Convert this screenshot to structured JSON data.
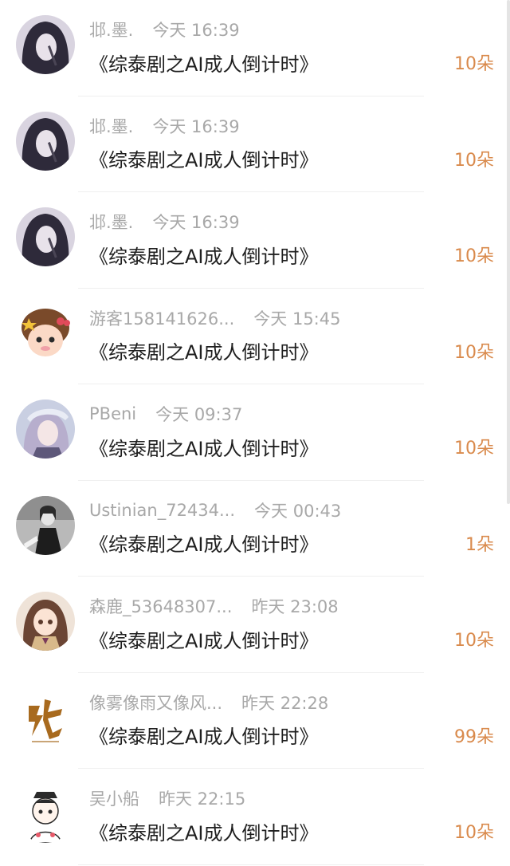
{
  "items": [
    {
      "user": "邶.墨.",
      "time": "今天 16:39",
      "title": "《综泰剧之AI成人倒计时》",
      "gift": "10朵",
      "avatar": "dark-hair-girl-avatar"
    },
    {
      "user": "邶.墨.",
      "time": "今天 16:39",
      "title": "《综泰剧之AI成人倒计时》",
      "gift": "10朵",
      "avatar": "dark-hair-girl-avatar"
    },
    {
      "user": "邶.墨.",
      "time": "今天 16:39",
      "title": "《综泰剧之AI成人倒计时》",
      "gift": "10朵",
      "avatar": "dark-hair-girl-avatar"
    },
    {
      "user": "游客158141626...",
      "time": "今天 15:45",
      "title": "《综泰剧之AI成人倒计时》",
      "gift": "10朵",
      "avatar": "cartoon-girl-avatar"
    },
    {
      "user": "PBeni",
      "time": "今天 09:37",
      "title": "《综泰剧之AI成人倒计时》",
      "gift": "10朵",
      "avatar": "anime-girl-cap-avatar"
    },
    {
      "user": "Ustinian_72434...",
      "time": "今天 00:43",
      "title": "《综泰剧之AI成人倒计时》",
      "gift": "1朵",
      "avatar": "grayscale-photo-avatar"
    },
    {
      "user": "森鹿_53648307...",
      "time": "昨天 23:08",
      "title": "《综泰剧之AI成人倒计时》",
      "gift": "10朵",
      "avatar": "anime-schoolgirl-avatar"
    },
    {
      "user": "像雾像雨又像风...",
      "time": "昨天 22:28",
      "title": "《综泰剧之AI成人倒计时》",
      "gift": "99朵",
      "avatar": "calligraphy-logo-avatar"
    },
    {
      "user": "吴小船",
      "time": "昨天 22:15",
      "title": "《综泰剧之AI成人倒计时》",
      "gift": "10朵",
      "avatar": "chibi-boy-avatar"
    }
  ],
  "colors": {
    "meta": "#a8a8a8",
    "title": "#1f1f1f",
    "gift": "#d98a4c",
    "divider": "#efefef"
  }
}
